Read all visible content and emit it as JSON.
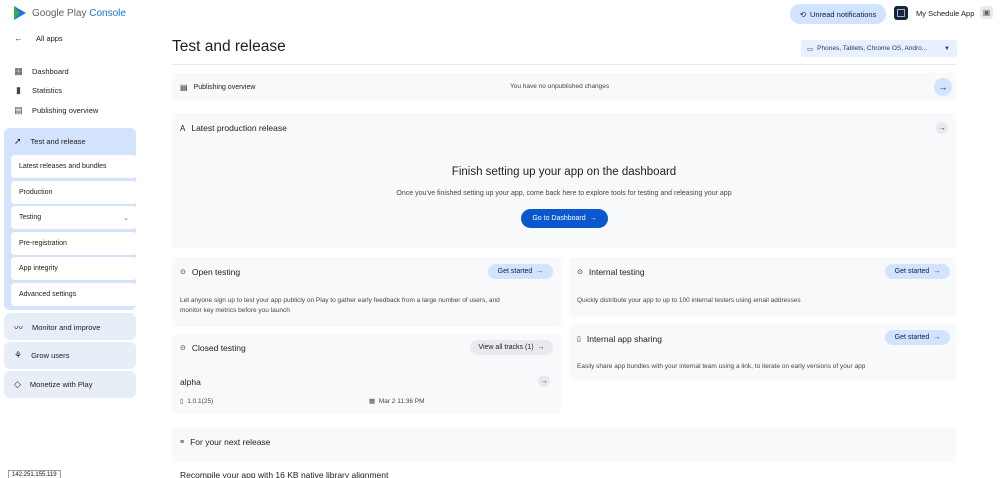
{
  "header": {
    "logo_google": "Google Play",
    "logo_console": "Console",
    "unread_label": "Unread notifications",
    "app_name": "My Schedule App"
  },
  "sidebar": {
    "back_label": "All apps",
    "top_items": [
      {
        "label": "Dashboard",
        "icon": "dashboard-icon"
      },
      {
        "label": "Statistics",
        "icon": "bar-chart-icon"
      },
      {
        "label": "Publishing overview",
        "icon": "publish-icon"
      }
    ],
    "test_release": {
      "label": "Test and release",
      "items": [
        {
          "label": "Latest releases and bundles"
        },
        {
          "label": "Production"
        },
        {
          "label": "Testing"
        },
        {
          "label": "Pre-registration"
        },
        {
          "label": "App integrity"
        },
        {
          "label": "Advanced settings"
        }
      ]
    },
    "monitor_label": "Monitor and improve",
    "grow_label": "Grow users",
    "monetize_label": "Monetize with Play",
    "ip_badge": "142.251.155.119"
  },
  "main": {
    "title": "Test and release",
    "device_select": "Phones, Tablets, Chrome OS, Andro...",
    "publishing_overview": {
      "title": "Publishing overview",
      "status": "You have no unpublished changes"
    },
    "latest_production": {
      "title": "Latest production release",
      "finish_title": "Finish setting up your app on the dashboard",
      "finish_text": "Once you've finished setting up your app, come back here to explore tools for testing and releasing your app",
      "button": "Go to Dashboard"
    },
    "open_testing": {
      "title": "Open testing",
      "button": "Get started",
      "desc_line1": "Let anyone sign up to test your app publicly on Play to gather early feedback from a large number of users, and",
      "desc_line2": "monitor key metrics before you launch"
    },
    "internal_testing": {
      "title": "Internal testing",
      "button": "Get started",
      "desc": "Quickly distribute your app to up to 100 internal testers using email addresses"
    },
    "closed_testing": {
      "title": "Closed testing",
      "button": "View all tracks (1)",
      "track_name": "alpha",
      "version": "1.0.1(25)",
      "date": "Mar 2 11:36 PM"
    },
    "internal_sharing": {
      "title": "Internal app sharing",
      "button": "Get started",
      "desc": "Easily share app bundles with your internal team using a link, to iterate on early versions of your app"
    },
    "next_release": {
      "title": "For your next release",
      "item": "Recompile your app with 16 KB native library alignment"
    }
  }
}
